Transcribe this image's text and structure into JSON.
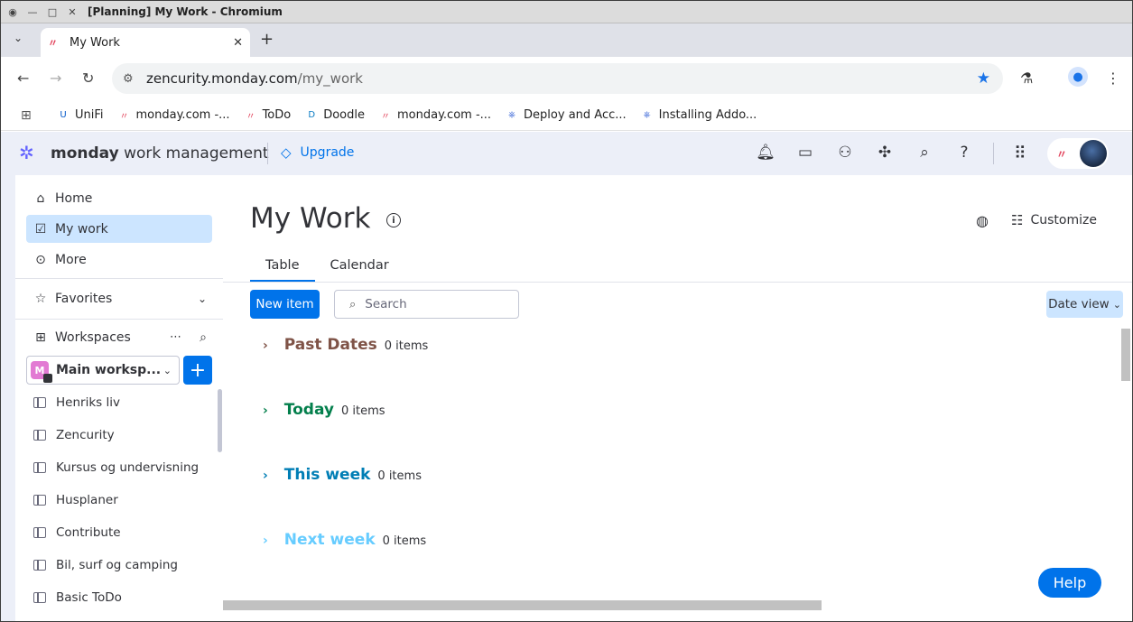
{
  "window": {
    "title": "[Planning] My Work - Chromium"
  },
  "browser": {
    "tab_title": "My Work",
    "url_host": "zencurity.monday.com",
    "url_path": "/my_work",
    "bookmarks": [
      {
        "label": "UniFi",
        "icon": "unifi-icon",
        "color": "#0559c9"
      },
      {
        "label": "monday.com -...",
        "icon": "monday-icon",
        "color": "#e2445c"
      },
      {
        "label": "ToDo",
        "icon": "monday-icon",
        "color": "#e2445c"
      },
      {
        "label": "Doodle",
        "icon": "doodle-icon",
        "color": "#0a7cc4"
      },
      {
        "label": "monday.com -...",
        "icon": "monday-icon",
        "color": "#e2445c"
      },
      {
        "label": "Deploy and Acc...",
        "icon": "helm-icon",
        "color": "#3f6ad8"
      },
      {
        "label": "Installing Addo...",
        "icon": "helm-icon",
        "color": "#3f6ad8"
      }
    ]
  },
  "header": {
    "brand_bold": "monday",
    "brand_rest": " work management",
    "upgrade_label": "Upgrade"
  },
  "sidebar": {
    "nav": [
      {
        "label": "Home",
        "icon": "home-icon"
      },
      {
        "label": "My work",
        "icon": "calendar-check-icon",
        "active": true
      },
      {
        "label": "More",
        "icon": "more-icon"
      }
    ],
    "favorites_label": "Favorites",
    "workspaces_label": "Workspaces",
    "workspace": {
      "badge": "M",
      "name": "Main worksp..."
    },
    "boards": [
      "Henriks liv",
      "Zencurity",
      "Kursus og undervisning",
      "Husplaner",
      "Contribute",
      "Bil, surf og camping",
      "Basic ToDo"
    ]
  },
  "main": {
    "title": "My Work",
    "customize_label": "Customize",
    "tabs": [
      "Table",
      "Calendar"
    ],
    "new_item_label": "New item",
    "search_placeholder": "Search",
    "date_view_label": "Date view",
    "groups": [
      {
        "name": "Past Dates",
        "count": "0 items",
        "color": "#7f5347"
      },
      {
        "name": "Today",
        "count": "0 items",
        "color": "#037f4c"
      },
      {
        "name": "This week",
        "count": "0 items",
        "color": "#007eb5"
      },
      {
        "name": "Next week",
        "count": "0 items",
        "color": "#66ccff"
      }
    ],
    "help_label": "Help"
  }
}
